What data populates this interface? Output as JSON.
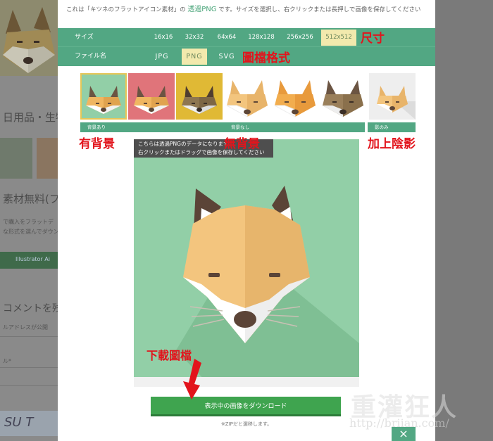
{
  "background_page": {
    "text_1": "日用品・生物",
    "text_2": "素材無料(フ",
    "small_1": "で購入をフラットデ",
    "small_2": "な形式を選んでダウン",
    "button": "Illustrator Ai",
    "text_3": "コメントを残す",
    "small_3": "ルアドレスが公開",
    "small_4": "ル*",
    "captcha": "SU T"
  },
  "modal": {
    "intro": {
      "before": "これは「キツネのフラットアイコン素材」の",
      "link": "透過PNG",
      "after": "です。サイズを選択し、右クリックまたは長押しで画像を保存してください"
    },
    "size_row": {
      "label": "サイズ",
      "options": [
        "16x16",
        "32x32",
        "64x64",
        "128x128",
        "256x256",
        "512x512"
      ],
      "selected": "512x512"
    },
    "filename_row": {
      "label": "ファイル名",
      "options": [
        "JPG",
        "PNG",
        "SVG"
      ],
      "selected": "PNG"
    },
    "groups": {
      "with_bg": "背景あり",
      "no_bg": "背景なし",
      "shadow_only": "影のみ"
    },
    "tooltip": {
      "line1": "こちらは透過PNGのデータになります",
      "line2": "右クリックまたはドラッグで画像を保存してください"
    },
    "download_button": "表示中の画像をダウンロード",
    "download_note": "※ZIPだと選移します。",
    "close_icon": "×"
  },
  "annotations": {
    "size": "尺寸",
    "format": "圖檔格式",
    "with_bg": "有背景",
    "no_bg": "無背景",
    "shadow": "加上陰影",
    "download": "下載圖檔"
  },
  "watermark": {
    "brand": "重灌狂人",
    "url": "http://briian.com/"
  },
  "colors": {
    "bar_green": "#52a783",
    "selected_option": "#f2e9ad",
    "preview_bg": "#92cfa7",
    "download_green": "#3fa44f",
    "annotation_red": "#e2141c"
  }
}
